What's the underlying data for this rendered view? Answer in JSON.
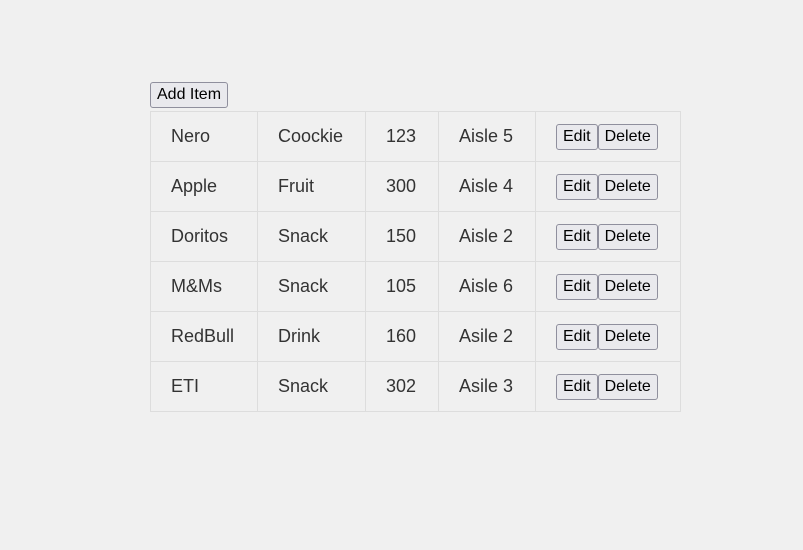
{
  "toolbar": {
    "add_label": "Add Item"
  },
  "table": {
    "rows": [
      {
        "name": "Nero",
        "category": "Coockie",
        "quantity": "123",
        "location": "Aisle 5"
      },
      {
        "name": "Apple",
        "category": "Fruit",
        "quantity": "300",
        "location": "Aisle 4"
      },
      {
        "name": "Doritos",
        "category": "Snack",
        "quantity": "150",
        "location": "Aisle 2"
      },
      {
        "name": "M&Ms",
        "category": "Snack",
        "quantity": "105",
        "location": "Aisle 6"
      },
      {
        "name": "RedBull",
        "category": "Drink",
        "quantity": "160",
        "location": "Asile 2"
      },
      {
        "name": "ETI",
        "category": "Snack",
        "quantity": "302",
        "location": "Asile 3"
      }
    ],
    "edit_label": "Edit",
    "delete_label": "Delete"
  }
}
